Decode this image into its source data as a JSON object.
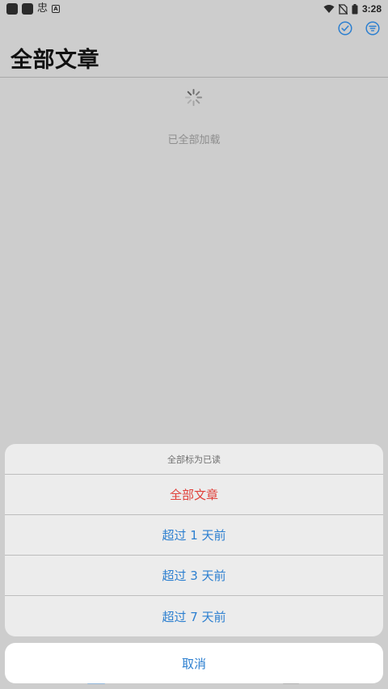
{
  "status_bar": {
    "time": "3:28",
    "notif_glyph": "忠",
    "notif_small": "A",
    "icons": [
      "app-icon",
      "app-icon",
      "wifi-icon",
      "no-sim-icon",
      "battery-icon"
    ]
  },
  "header": {
    "title": "全部文章",
    "action_icons": [
      "check-circle-icon",
      "filter-icon"
    ],
    "accent_color": "#2c7fd0"
  },
  "content": {
    "loading_status": "已全部加载"
  },
  "action_sheet": {
    "title": "全部标为已读",
    "options": [
      {
        "label": "全部文章",
        "style": "destructive"
      },
      {
        "label": "超过 1 天前",
        "style": "default"
      },
      {
        "label": "超过 3 天前",
        "style": "default"
      },
      {
        "label": "超过 7 天前",
        "style": "default"
      }
    ],
    "cancel_label": "取消",
    "option_color": "#2c7fd0",
    "destructive_color": "#e0403a"
  }
}
